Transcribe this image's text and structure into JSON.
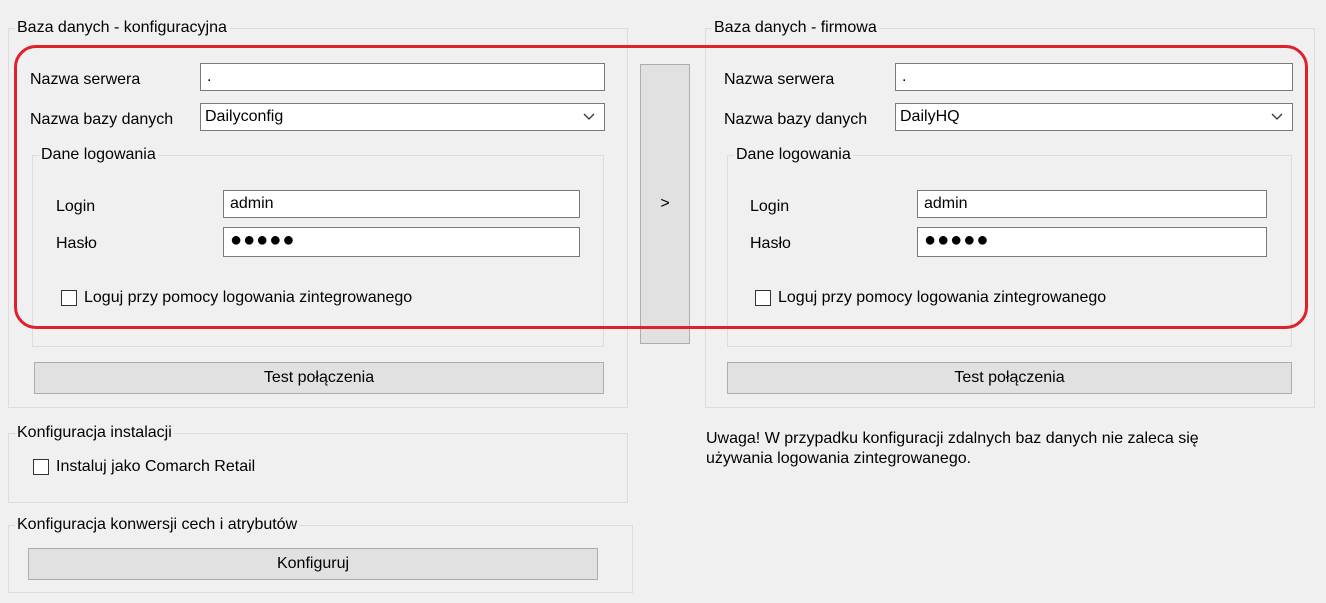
{
  "left_db": {
    "title": "Baza danych - konfiguracyjna",
    "server_label": "Nazwa serwera",
    "server_value": ".",
    "db_label": "Nazwa bazy danych",
    "db_value": "Dailyconfig",
    "login_group": "Dane logowania",
    "login_label": "Login",
    "login_value": "admin",
    "password_label": "Hasło",
    "password_value": "●●●●●",
    "integrated_label": "Loguj przy pomocy logowania zintegrowanego",
    "test_label": "Test połączenia"
  },
  "copy_button_label": ">",
  "right_db": {
    "title": "Baza danych - firmowa",
    "server_label": "Nazwa serwera",
    "server_value": ".",
    "db_label": "Nazwa bazy danych",
    "db_value": "DailyHQ",
    "login_group": "Dane logowania",
    "login_label": "Login",
    "login_value": "admin",
    "password_label": "Hasło",
    "password_value": "●●●●●",
    "integrated_label": "Loguj przy pomocy logowania zintegrowanego",
    "test_label": "Test połączenia"
  },
  "install_config": {
    "title": "Konfiguracja instalacji",
    "retail_label": "Instaluj jako Comarch Retail"
  },
  "conversion_config": {
    "title": "Konfiguracja konwersji cech i atrybutów",
    "button_label": "Konfiguruj"
  },
  "warning": {
    "line1": "Uwaga! W przypadku konfiguracji zdalnych baz danych nie zaleca się",
    "line2": "używania logowania zintegrowanego."
  },
  "colors": {
    "highlight": "#e0202c"
  }
}
